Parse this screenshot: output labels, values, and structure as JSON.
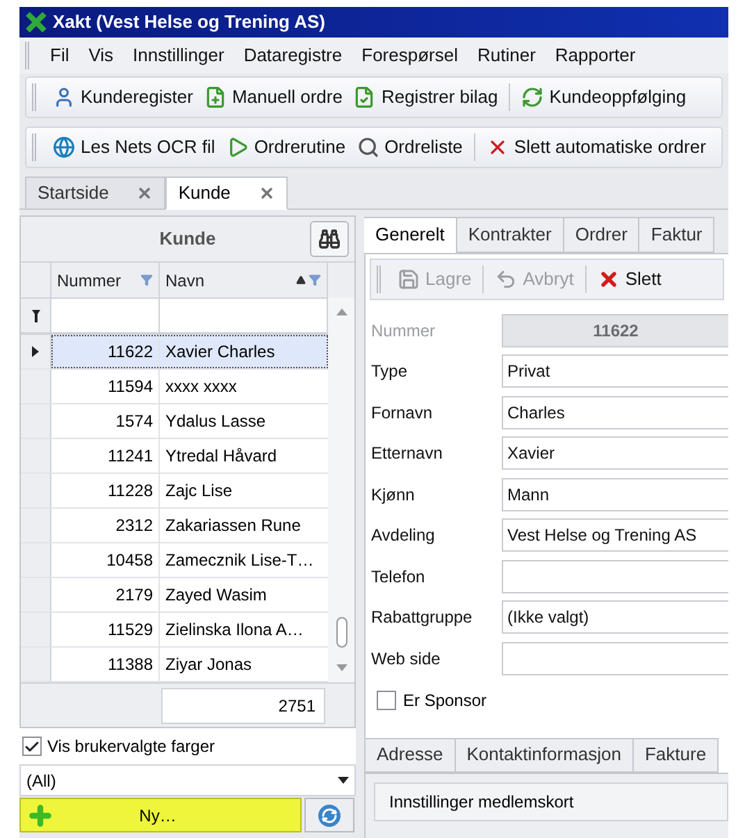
{
  "window": {
    "title": "Xakt (Vest Helse og Trening AS)"
  },
  "menu": [
    "Fil",
    "Vis",
    "Innstillinger",
    "Dataregistre",
    "Forespørsel",
    "Rutiner",
    "Rapporter"
  ],
  "toolbar_1": [
    "Kunderegister",
    "Manuell ordre",
    "Registrer bilag",
    "Kundeoppfølging"
  ],
  "toolbar_2": [
    "Les Nets OCR fil",
    "Ordrerutine",
    "Ordreliste",
    "Slett automatiske ordrer"
  ],
  "doc_tabs": [
    {
      "label": "Startside",
      "selected": false
    },
    {
      "label": "Kunde",
      "selected": true
    }
  ],
  "customer_list": {
    "title": "Kunde",
    "columns": [
      "Nummer",
      "Navn"
    ],
    "rows": [
      {
        "nummer": "11622",
        "navn": "Xavier Charles",
        "selected": true
      },
      {
        "nummer": "11594",
        "navn": "xxxx xxxx",
        "selected": false
      },
      {
        "nummer": "1574",
        "navn": "Ydalus Lasse",
        "selected": false
      },
      {
        "nummer": "11241",
        "navn": "Ytredal Håvard",
        "selected": false
      },
      {
        "nummer": "11228",
        "navn": "Zajc Lise",
        "selected": false
      },
      {
        "nummer": "2312",
        "navn": "Zakariassen Rune",
        "selected": false
      },
      {
        "nummer": "10458",
        "navn": "Zamecznik Lise-T…",
        "selected": false
      },
      {
        "nummer": "2179",
        "navn": "Zayed Wasim",
        "selected": false
      },
      {
        "nummer": "11529",
        "navn": "Zielinska Ilona A…",
        "selected": false
      },
      {
        "nummer": "11388",
        "navn": "Ziyar Jonas",
        "selected": false
      }
    ],
    "count": "2751",
    "show_colors": {
      "label": "Vis brukervalgte farger",
      "checked": true
    },
    "filter": {
      "value": "(All)"
    },
    "new_button": "Ny…"
  },
  "detail_tabs": [
    {
      "label": "Generelt",
      "selected": true
    },
    {
      "label": "Kontrakter",
      "selected": false
    },
    {
      "label": "Ordrer",
      "selected": false
    },
    {
      "label": "Faktur",
      "selected": false
    }
  ],
  "detail_toolbar": [
    {
      "label": "Lagre",
      "disabled": true
    },
    {
      "label": "Avbryt",
      "disabled": true
    },
    {
      "label": "Slett",
      "disabled": false
    }
  ],
  "fields": [
    {
      "label": "Nummer",
      "value": "11622",
      "disabled": true
    },
    {
      "label": "Type",
      "value": "Privat",
      "disabled": false
    },
    {
      "label": "Fornavn",
      "value": "Charles",
      "disabled": false
    },
    {
      "label": "Etternavn",
      "value": "Xavier",
      "disabled": false
    },
    {
      "label": "Kjønn",
      "value": "Mann",
      "disabled": false
    },
    {
      "label": "Avdeling",
      "value": "Vest Helse og Trening AS",
      "disabled": false
    },
    {
      "label": "Telefon",
      "disabled": false
    },
    {
      "label": "Rabattgruppe",
      "value": "(Ikke valgt)",
      "disabled": false
    },
    {
      "label": "Web side",
      "disabled": false
    }
  ],
  "sponsor": {
    "label": "Er Sponsor",
    "checked": false
  },
  "sub_tabs": [
    {
      "label": "Adresse",
      "selected": false
    },
    {
      "label": "Kontaktinformasjon",
      "selected": false
    },
    {
      "label": "Fakture",
      "selected": false
    }
  ],
  "section": {
    "label": "Innstillinger medlemskort"
  }
}
